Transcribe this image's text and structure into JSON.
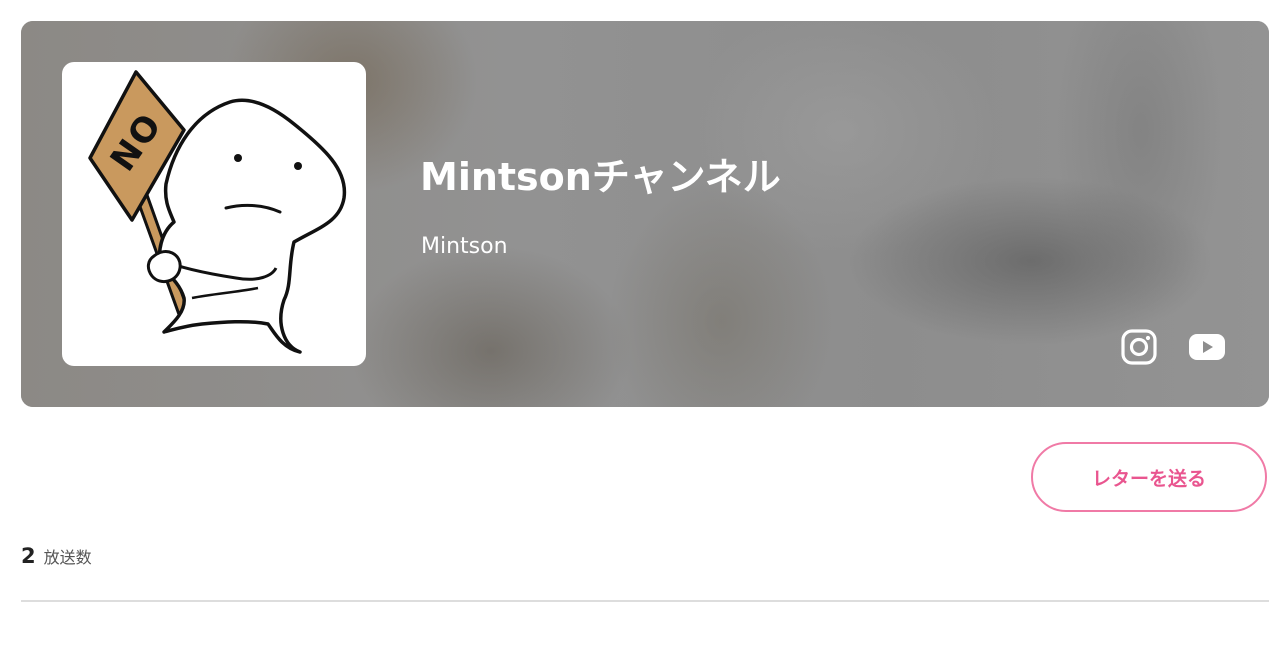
{
  "channel": {
    "title": "Mintsonチャンネル",
    "owner": "Mintson",
    "avatar_sign_text": "NO"
  },
  "social": [
    {
      "icon": "instagram-icon"
    },
    {
      "icon": "youtube-icon"
    }
  ],
  "actions": {
    "send_letter_label": "レターを送る"
  },
  "stats": {
    "broadcast_count": "2",
    "broadcast_label": "放送数"
  },
  "colors": {
    "accent": "#e9558f",
    "accent_border": "#f07aa6",
    "banner_gray": "#8e8e8e",
    "sign_brown": "#c9995e"
  }
}
